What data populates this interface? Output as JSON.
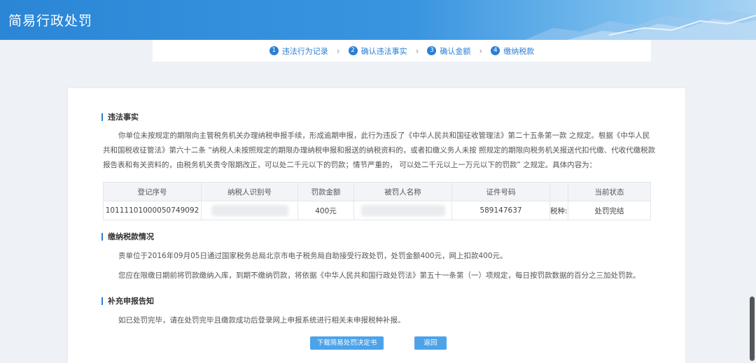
{
  "app": {
    "title": "简易行政处罚"
  },
  "steps": [
    {
      "num": "1",
      "label": "违法行为记录"
    },
    {
      "num": "2",
      "label": "确认违法事实"
    },
    {
      "num": "3",
      "label": "确认金额"
    },
    {
      "num": "4",
      "label": "缴纳税款"
    }
  ],
  "violation": {
    "title": "违法事实",
    "text": "你单位未按规定的期限向主管税务机关办理纳税申报手续，形成逾期申报，此行为违反了《中华人民共和国征收管理法》第二十五条第一款 之规定。根据《中华人民共和国税收征管法》第六十二条 “纳税人未按照规定的期限办理纳税申报和报送的纳税资料的，或者扣缴义务人未按 照规定的期限向税务机关报送代扣代缴、代收代缴税款报告表和有关资料的，由税务机关责令限期改正，可以处二千元以下的罚款；情节严重的， 可以处二千元以上一万元以下的罚款” 之规定。具体内容为：",
    "table": {
      "headers": [
        "登记序号",
        "纳税人识别号",
        "罚款金额",
        "被罚人名称",
        "证件号码",
        "",
        "当前状态"
      ],
      "row": {
        "reg_no": "10111101000050749092",
        "taxpayer_id": "",
        "amount": "400元",
        "name": "",
        "cert_no": "589147637",
        "tax_type": "税种:",
        "status": "处罚完结"
      }
    }
  },
  "payment": {
    "title": "缴纳税款情况",
    "text1": "贵单位于2016年09月05日通过国家税务总局北京市电子税务局自助接受行政处罚，处罚金额400元，网上扣款400元。",
    "text2": "您应在限缴日期前将罚款缴纳入库，到期不缴纳罚款，将依据《中华人民共和国行政处罚法》第五十一条第（一）项规定，每日按罚款数据的百分之三加处罚款。"
  },
  "supplement": {
    "title": "补充申报告知",
    "text": "如已处罚完毕，请在处罚完毕且缴款成功后登录网上申报系统进行相关未申报税种补报。"
  },
  "buttons": {
    "download": "下载简易处罚决定书",
    "back": "返回"
  },
  "colors": {
    "primary": "#2a7fd4",
    "button": "#4da3ea"
  }
}
